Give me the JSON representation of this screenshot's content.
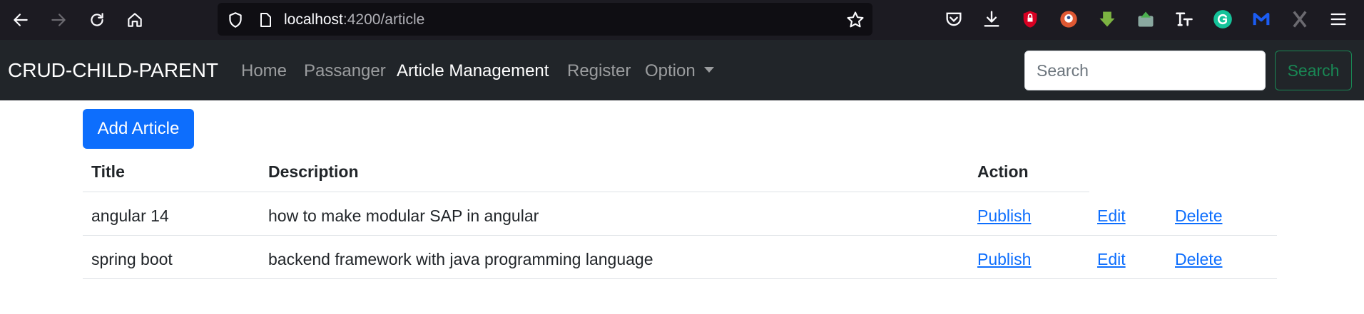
{
  "browser": {
    "url_host": "localhost",
    "url_path": ":4200/article"
  },
  "navbar": {
    "brand": "CRUD-CHILD-PARENT",
    "links": [
      "Home",
      "Passanger",
      "Article Management",
      "Register",
      "Option"
    ],
    "active_link": "Article Management",
    "search_placeholder": "Search",
    "search_button": "Search"
  },
  "main": {
    "add_button": "Add Article",
    "columns": [
      "Title",
      "Description",
      "Action"
    ],
    "rows": [
      {
        "title": "angular 14",
        "description": "how to make modular SAP in angular",
        "actions": [
          "Publish",
          "Edit",
          "Delete"
        ]
      },
      {
        "title": "spring boot",
        "description": "backend framework with java programming language",
        "actions": [
          "Publish",
          "Edit",
          "Delete"
        ]
      }
    ]
  },
  "colors": {
    "navbar_bg": "#212529",
    "primary": "#0d6efd",
    "success": "#198754",
    "browser_bg": "#1c1b22"
  }
}
